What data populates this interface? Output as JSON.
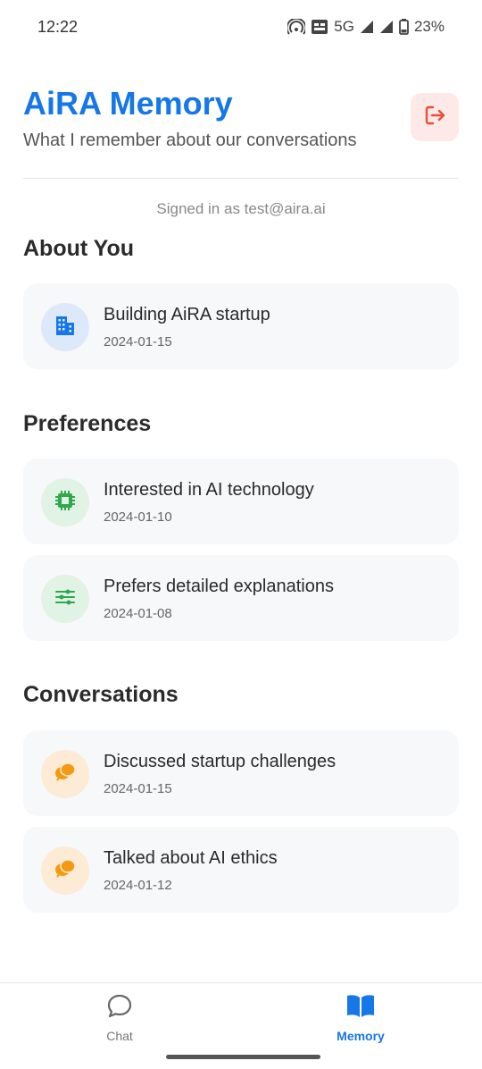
{
  "status_bar": {
    "time": "12:22",
    "network": "5G",
    "battery": "23%",
    "icons": [
      "hotspot-icon",
      "volte-icon",
      "signal-icon",
      "signal-icon",
      "battery-icon"
    ]
  },
  "header": {
    "title": "AiRA Memory",
    "subtitle": "What I remember about our conversations",
    "logout_icon": "logout-icon"
  },
  "account": {
    "signed_in_text": "Signed in as test@aira.ai"
  },
  "sections": {
    "about": {
      "title": "About You",
      "items": [
        {
          "title": "Building AiRA startup",
          "date": "2024-01-15",
          "icon": "building-icon"
        }
      ]
    },
    "preferences": {
      "title": "Preferences",
      "items": [
        {
          "title": "Interested in AI technology",
          "date": "2024-01-10",
          "icon": "chip-icon"
        },
        {
          "title": "Prefers detailed explanations",
          "date": "2024-01-08",
          "icon": "sliders-icon"
        }
      ]
    },
    "conversations": {
      "title": "Conversations",
      "items": [
        {
          "title": "Discussed startup challenges",
          "date": "2024-01-15",
          "icon": "chat-bubbles-icon"
        },
        {
          "title": "Talked about AI ethics",
          "date": "2024-01-12",
          "icon": "chat-bubbles-icon"
        }
      ]
    }
  },
  "bottom_nav": {
    "items": [
      {
        "label": "Chat",
        "icon": "chat-icon",
        "active": false
      },
      {
        "label": "Memory",
        "icon": "book-icon",
        "active": true
      }
    ]
  },
  "colors": {
    "accent": "#1677e8",
    "logout": "#e8503a",
    "green": "#2fa84f",
    "orange": "#f39a12"
  }
}
